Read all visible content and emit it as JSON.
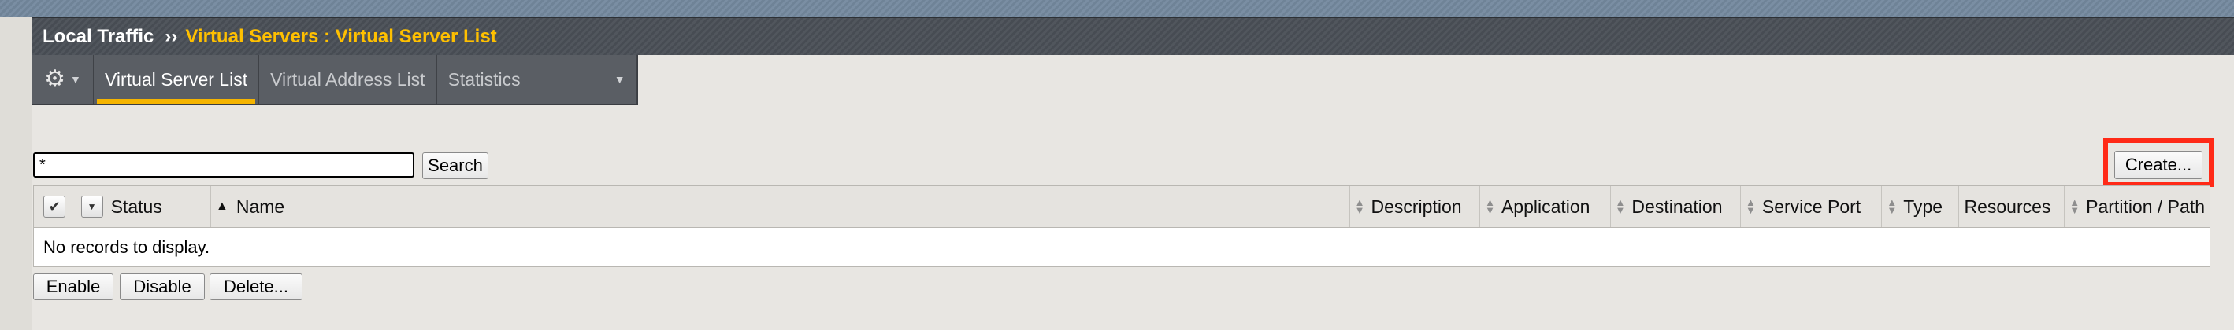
{
  "header": {
    "breadcrumb_root": "Local Traffic",
    "separator": "››",
    "breadcrumb_current": "Virtual Servers : Virtual Server List"
  },
  "tabs": [
    {
      "label": "Virtual Server List",
      "active": true
    },
    {
      "label": "Virtual Address List",
      "active": false
    },
    {
      "label": "Statistics",
      "active": false
    }
  ],
  "icons": {
    "gear": "gear-icon",
    "menu_caret": "chevron-down-icon"
  },
  "search": {
    "value": "*",
    "button_label": "Search"
  },
  "create_button_label": "Create...",
  "table": {
    "columns": [
      "Status",
      "Name",
      "Description",
      "Application",
      "Destination",
      "Service Port",
      "Type",
      "Resources",
      "Partition / Path"
    ],
    "empty_message": "No records to display."
  },
  "actions": {
    "enable": "Enable",
    "disable": "Disable",
    "delete": "Delete..."
  },
  "colors": {
    "accent": "#f5b400",
    "breadcrumb_current": "#ffc000",
    "highlight": "#ff2a17"
  }
}
